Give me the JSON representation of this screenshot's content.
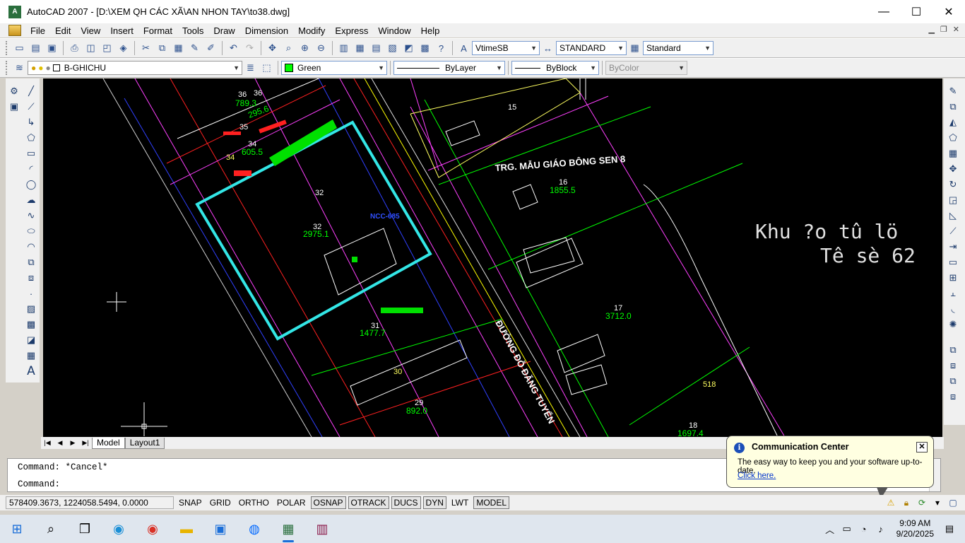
{
  "window": {
    "title": "AutoCAD 2007 - [D:\\XEM QH CÁC XÃ\\AN NHON TAY\\to38.dwg]",
    "icon_text": "A",
    "controls": [
      "—",
      "☐",
      "✕"
    ]
  },
  "menu": [
    "File",
    "Edit",
    "View",
    "Insert",
    "Format",
    "Tools",
    "Draw",
    "Dimension",
    "Modify",
    "Express",
    "Window",
    "Help"
  ],
  "toolbar1": {
    "text_style": "VtimeSB",
    "dim_style": "STANDARD",
    "table_style": "Standard"
  },
  "toolbar2": {
    "layer": "B-GHICHU",
    "color": "Green",
    "color_hex": "#00ff00",
    "linetype": "ByLayer",
    "lineweight": "ByBlock",
    "plotstyle": "ByColor"
  },
  "drawing": {
    "background": "#000000",
    "accent_cyan": "#33e6e6",
    "labels": {
      "school": "TRG. MẪU GIÁO BÔNG SEN 8",
      "khu_line1": "Khu ?o tû lö",
      "khu_line2": "Tê sè 62",
      "road": "ĐƯỜNG ĐỖ ĐĂNG TUYỂN",
      "lot_16": "16",
      "lot_16_area": "1855.5",
      "lot_17": "17",
      "lot_17_area": "3712.0",
      "lot_18": "18",
      "lot_18_area": "1697.4",
      "lot_15": "15",
      "lot_32": "32",
      "lot_32b": "32",
      "lot_32_area": "2975.1",
      "lot_31": "31",
      "lot_31_area": "1477.7",
      "lot_30": "30",
      "lot_29": "29",
      "lot_29_area": "892.0",
      "lot_34": "34",
      "lot_34b": "34",
      "lot_34_area": "605.5",
      "lot_35": "35",
      "lot_35_area": "295.6",
      "lot_36a": "36",
      "lot_36b": "36",
      "lot_36_area": "789.3",
      "lot_518": "518",
      "ncc": "NCC-685"
    }
  },
  "tabs": [
    "Model",
    "Layout1"
  ],
  "command": {
    "line1": "Command: *Cancel*",
    "line2": "Command:"
  },
  "status": {
    "coords": "578409.3673, 1224058.5494, 0.0000",
    "buttons": [
      {
        "label": "SNAP",
        "on": false
      },
      {
        "label": "GRID",
        "on": false
      },
      {
        "label": "ORTHO",
        "on": false
      },
      {
        "label": "POLAR",
        "on": false
      },
      {
        "label": "OSNAP",
        "on": true
      },
      {
        "label": "OTRACK",
        "on": true
      },
      {
        "label": "DUCS",
        "on": true
      },
      {
        "label": "DYN",
        "on": true
      },
      {
        "label": "LWT",
        "on": false
      },
      {
        "label": "MODEL",
        "on": true
      }
    ]
  },
  "comm_center": {
    "title": "Communication Center",
    "message": "The easy way to keep you and your software up-to-date.",
    "link": "Click here."
  },
  "taskbar": {
    "time": "9:09 AM",
    "date": "9/20/2025"
  }
}
